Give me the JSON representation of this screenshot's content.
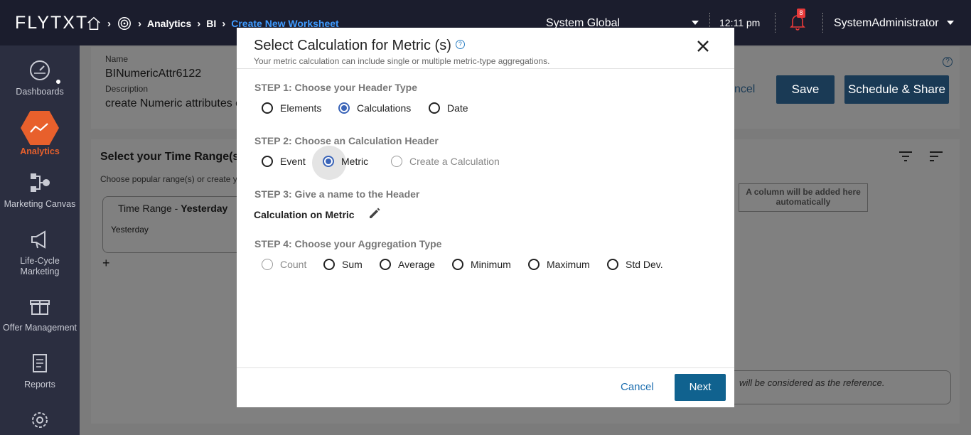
{
  "topbar": {
    "logo": "FLYTXT",
    "breadcrumbs": [
      "Analytics",
      "BI",
      "Create New Worksheet"
    ],
    "scope": "System Global",
    "time": "12:11 pm",
    "notification_count": "8",
    "user": "SystemAdministrator"
  },
  "sidebar": {
    "items": [
      {
        "label": "Dashboards",
        "icon": "speedometer-icon"
      },
      {
        "label": "Analytics",
        "icon": "line-chart-icon"
      },
      {
        "label": "Marketing Canvas",
        "icon": "flow-icon"
      },
      {
        "label": "Life-Cycle Marketing",
        "icon": "megaphone-icon"
      },
      {
        "label": "Offer Management",
        "icon": "gift-icon"
      },
      {
        "label": "Reports",
        "icon": "document-icon"
      },
      {
        "label": "",
        "icon": "gear-icon"
      }
    ]
  },
  "background": {
    "name_label": "Name",
    "name_value": "BINumericAttr6122",
    "description_label": "Description",
    "description_value": "create Numeric attributes c",
    "cancel_partial": "ncel",
    "save_label": "Save",
    "schedule_label": "Schedule & Share",
    "time_range_title": "Select your Time Range(s",
    "time_range_sub": "Choose popular range(s) or create y",
    "time_card_title_prefix": "Time Range - ",
    "time_card_title_bold": "Yesterday",
    "time_card_value": "Yesterday",
    "add_symbol": "+",
    "column_placeholder": "A column will be added here automatically",
    "reference_note": "will be considered as the reference.",
    "help_symbol": "?"
  },
  "modal": {
    "title": "Select Calculation for Metric (s)",
    "help_symbol": "?",
    "subtitle": "Your metric calculation can include single or multiple metric-type aggregations.",
    "step1": {
      "label": "STEP 1: Choose your Header Type",
      "options": [
        {
          "label": "Elements",
          "selected": false,
          "disabled": false
        },
        {
          "label": "Calculations",
          "selected": true,
          "disabled": false
        },
        {
          "label": "Date",
          "selected": false,
          "disabled": false
        }
      ]
    },
    "step2": {
      "label": "STEP 2: Choose an Calculation Header",
      "options": [
        {
          "label": "Event",
          "selected": false,
          "disabled": false
        },
        {
          "label": "Metric",
          "selected": true,
          "disabled": false
        },
        {
          "label": "Create a Calculation",
          "selected": false,
          "disabled": true
        }
      ]
    },
    "step3": {
      "label": "STEP 3: Give a name to the Header",
      "header_name": "Calculation on Metric"
    },
    "step4": {
      "label": "STEP 4: Choose your Aggregation Type",
      "options": [
        {
          "label": "Count",
          "selected": false,
          "disabled": true
        },
        {
          "label": "Sum",
          "selected": false,
          "disabled": false
        },
        {
          "label": "Average",
          "selected": false,
          "disabled": false
        },
        {
          "label": "Minimum",
          "selected": false,
          "disabled": false
        },
        {
          "label": "Maximum",
          "selected": false,
          "disabled": false
        },
        {
          "label": "Std Dev.",
          "selected": false,
          "disabled": false
        }
      ]
    },
    "cancel_label": "Cancel",
    "next_label": "Next"
  },
  "colors": {
    "topbar_bg": "#1b1d2d",
    "sidebar_bg": "#2b2e40",
    "accent_orange": "#e8602c",
    "primary_blue": "#10628f",
    "radio_selected": "#3a64b8",
    "link_blue": "#1e6fb0"
  }
}
